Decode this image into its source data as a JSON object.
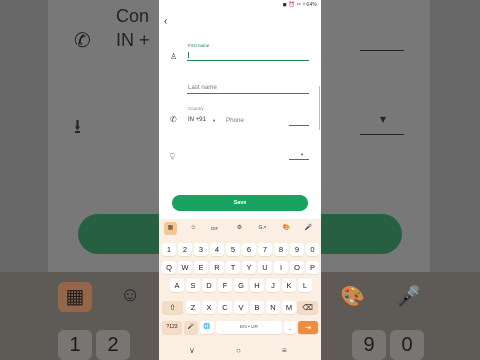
{
  "status_bar": {
    "text": "◼ ⏰ ⁴⁶ ᴵᴵ 64%"
  },
  "form": {
    "back_label": "‹",
    "first_name_label": "First name",
    "last_name_placeholder": "Last name",
    "country_label": "Country",
    "country_value": "IN +91",
    "phone_placeholder": "Phone",
    "save_label": "Save"
  },
  "icons": {
    "person": "person-icon",
    "phone": "phone-icon",
    "contact": "contact-card-icon"
  },
  "keyboard": {
    "toolbar": [
      "▦",
      "☺",
      "GIF",
      "⚙",
      "G↗",
      "🎨",
      "🎤"
    ],
    "number_row": [
      "1",
      "2",
      "3",
      "4",
      "5",
      "6",
      "7",
      "8",
      "9",
      "0"
    ],
    "row1": [
      "Q",
      "W",
      "E",
      "R",
      "T",
      "Y",
      "U",
      "I",
      "O",
      "P"
    ],
    "row2": [
      "A",
      "S",
      "D",
      "F",
      "G",
      "H",
      "J",
      "K",
      "L"
    ],
    "row3": [
      "Z",
      "X",
      "C",
      "V",
      "B",
      "N",
      "M"
    ],
    "shift": "⇧",
    "backspace": "⌫",
    "symbols": "?123",
    "mic": "🎤",
    "globe": "🌐",
    "space": "EN • UR",
    "period": ".",
    "enter": "⇥"
  },
  "nav_bar": {
    "back": "∨",
    "home": "○",
    "recents": "≡"
  },
  "background": {
    "top_label": "Con",
    "country_hint": "IN +",
    "key_row_top": [
      "2",
      "9",
      "0",
      "1"
    ]
  },
  "colors": {
    "accent": "#1aa260",
    "keyboard_bg": "#fbeee2",
    "enter_key": "#f08a3c"
  }
}
